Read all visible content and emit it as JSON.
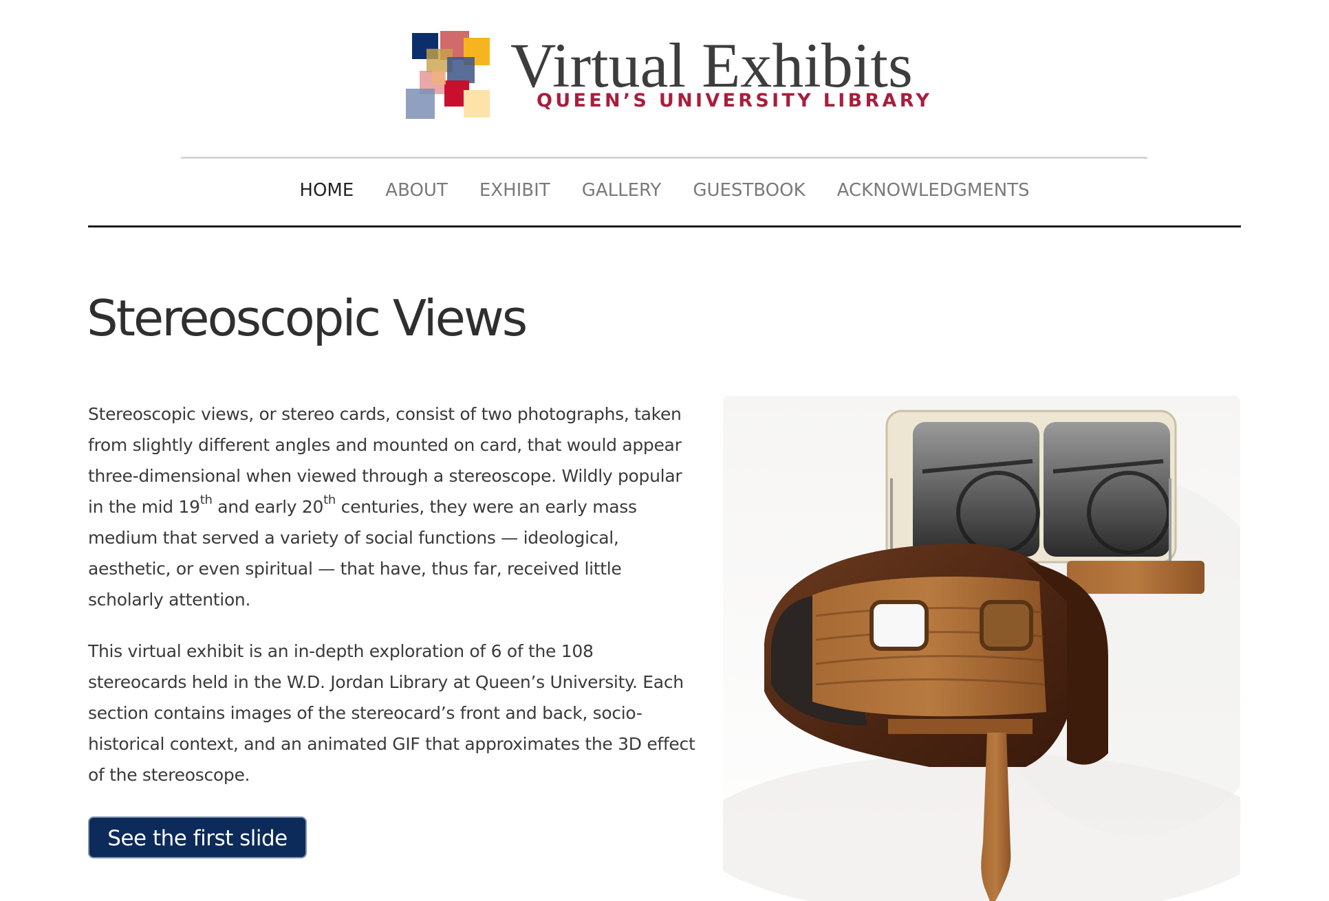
{
  "header": {
    "logo_title": "Virtual Exhibits",
    "logo_subtitle": "QUEEN’S UNIVERSITY LIBRARY",
    "logo_colors": [
      "#0c2f6b",
      "#cc5a5a",
      "#f6b520",
      "#c8102e",
      "#7d8fb5",
      "#fde3a8"
    ]
  },
  "nav": {
    "items": [
      {
        "label": "HOME",
        "active": true
      },
      {
        "label": "ABOUT",
        "active": false
      },
      {
        "label": "EXHIBIT",
        "active": false
      },
      {
        "label": "GALLERY",
        "active": false
      },
      {
        "label": "GUESTBOOK",
        "active": false
      },
      {
        "label": "ACKNOWLEDGMENTS",
        "active": false
      }
    ]
  },
  "main": {
    "title": "Stereoscopic Views",
    "paragraph1": {
      "part1": "Stereoscopic views, or stereo cards, consist of two photographs, taken from slightly different angles and mounted on card, that would appear three-dimensional when viewed through a stereoscope. Wildly popular in the mid 19",
      "sup1": "th",
      "part2": " and early 20",
      "sup2": "th",
      "part3": " centuries, they were an early mass medium that served a variety of social functions — ideological, aesthetic, or even spiritual — that have, thus far, received little scholarly attention."
    },
    "paragraph2": "This virtual exhibit is an in-depth exploration of 6 of the 108 stereocards held in the W.D. Jordan Library at Queen’s University. Each section contains images of the stereocard’s front and back, socio-historical context, and an animated GIF that approximates the 3D effect of the stereoscope.",
    "cta_label": "See the first slide"
  },
  "colors": {
    "nav_active": "#222222",
    "nav_inactive": "#7a7a7a",
    "button_bg": "#0c2a5a",
    "subtitle_red": "#a81e3c"
  }
}
